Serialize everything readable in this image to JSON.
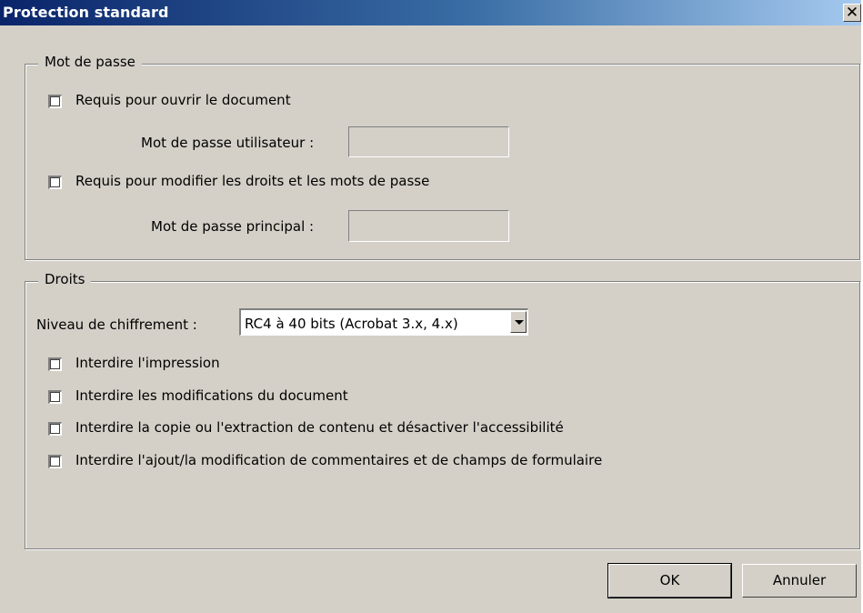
{
  "window": {
    "title": "Protection standard",
    "close_glyph": "✕"
  },
  "password_group": {
    "title": "Mot de passe",
    "require_open": {
      "label": "Requis pour ouvrir le document",
      "checked": false
    },
    "user_password": {
      "label": "Mot de passe utilisateur :",
      "value": ""
    },
    "require_permissions": {
      "label": "Requis pour modifier les droits et les mots de passe",
      "checked": false
    },
    "master_password": {
      "label": "Mot de passe principal :",
      "value": ""
    }
  },
  "rights_group": {
    "title": "Droits",
    "encryption": {
      "label": "Niveau de chiffrement :",
      "selected": "RC4 à 40 bits (Acrobat 3.x, 4.x)"
    },
    "options": [
      {
        "label": "Interdire l'impression",
        "checked": false
      },
      {
        "label": "Interdire les modifications du document",
        "checked": false
      },
      {
        "label": "Interdire la copie ou l'extraction de contenu et désactiver l'accessibilité",
        "checked": false
      },
      {
        "label": "Interdire l'ajout/la modification de commentaires et de champs de formulaire",
        "checked": false
      }
    ]
  },
  "buttons": {
    "ok": "OK",
    "cancel": "Annuler"
  },
  "colors": {
    "titlebar_start": "#0a246a",
    "titlebar_end": "#a6caf0",
    "dialog_bg": "#d4d0c8"
  }
}
